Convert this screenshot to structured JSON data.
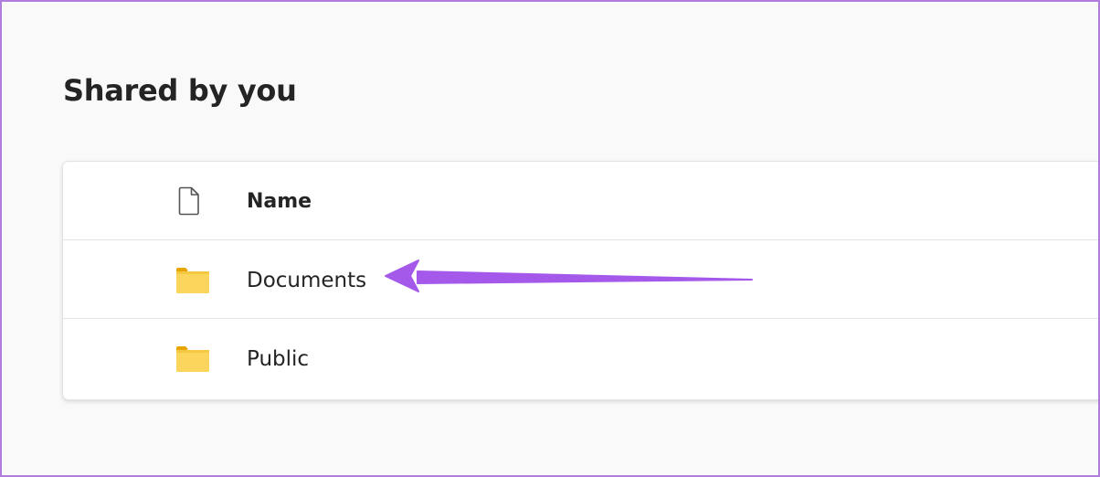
{
  "page": {
    "title": "Shared by you"
  },
  "list": {
    "header": {
      "label": "Name",
      "icon": "document-icon"
    },
    "items": [
      {
        "label": "Documents",
        "icon": "folder-icon"
      },
      {
        "label": "Public",
        "icon": "folder-icon"
      }
    ]
  },
  "colors": {
    "folder_body": "#fcd55c",
    "folder_tab": "#e8a400",
    "annotation_arrow": "#a559ea",
    "frame_border": "#b07ddc"
  }
}
